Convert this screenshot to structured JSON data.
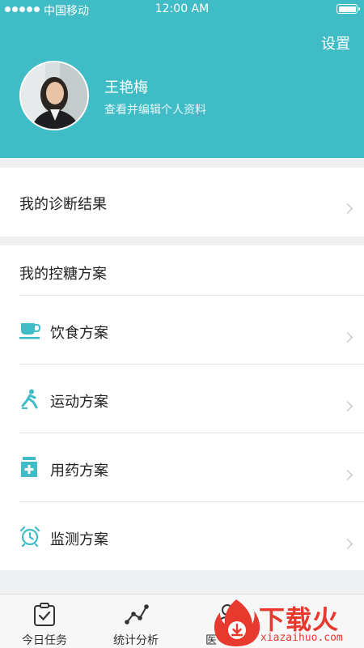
{
  "status_bar": {
    "carrier": "中国移动",
    "time": "12:00 AM"
  },
  "header": {
    "settings_label": "设置",
    "profile_name": "王艳梅",
    "profile_subtitle": "查看并编辑个人资料"
  },
  "diagnosis": {
    "label": "我的诊断结果"
  },
  "plans": {
    "title": "我的控糖方案",
    "items": [
      {
        "label": "饮食方案",
        "icon": "cup-icon"
      },
      {
        "label": "运动方案",
        "icon": "running-icon"
      },
      {
        "label": "用药方案",
        "icon": "medicine-icon"
      },
      {
        "label": "监测方案",
        "icon": "alarm-clock-icon"
      }
    ]
  },
  "tabbar": {
    "items": [
      {
        "label": "今日任务",
        "icon": "clipboard-check-icon"
      },
      {
        "label": "统计分析",
        "icon": "line-chart-icon"
      },
      {
        "label": "医",
        "icon": "doctor-icon"
      }
    ]
  },
  "watermark": {
    "text": "下载火",
    "url": "xiazaihuo.com"
  },
  "colors": {
    "accent": "#3fbcc6",
    "background": "#eef0f1",
    "watermark": "#e8392f"
  }
}
